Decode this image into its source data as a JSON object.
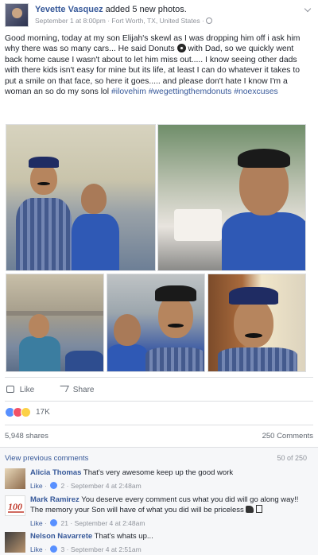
{
  "post": {
    "author": "Yevette Vasquez",
    "action": "added 5 new photos.",
    "date": "September 1 at 8:00pm",
    "location": "Fort Worth, TX, United States",
    "text_part1": "Good morning, today at my son Elijah's skewl as I was dropping him off i ask him why there was so many cars... He said Donuts",
    "text_part2": "with Dad, so we quickly went back home cause I wasn't about to let him miss out..... I know seeing other dads with there kids isn't easy for mine but its life, at least I can do whatever it takes to put a smile on that face, so here it goes..... and please don't hate I know I'm a woman an so do my sons lol",
    "hashtags": "#ilovehim #wegettingthemdonuts #noexcuses"
  },
  "actions": {
    "like_label": "Like",
    "share_label": "Share"
  },
  "stats": {
    "reaction_count": "17K",
    "shares": "5,948 shares",
    "comments": "250 Comments"
  },
  "comments_section": {
    "view_previous": "View previous comments",
    "count": "50 of 250",
    "items": [
      {
        "name": "Alicia Thomas",
        "text": "That's very awesome keep up the good work",
        "like_label": "Like",
        "reactions": "2",
        "time": "September 4 at 2:48am"
      },
      {
        "name": "Mark Ramirez",
        "text": "You deserve every comment cus what you did will go along way!! The memory your Son will have of what you did will be priceless",
        "like_label": "Like",
        "reactions": "21",
        "time": "September 4 at 2:48am"
      },
      {
        "name": "Nelson Navarrete",
        "text": "That's whats up...",
        "like_label": "Like",
        "reactions": "3",
        "time": "September 4 at 2:51am"
      }
    ]
  },
  "colors": {
    "link": "#365899",
    "like_reaction": "#5890ff",
    "love_reaction": "#f25268",
    "haha_reaction": "#fcd146",
    "meta_gray": "#90949c"
  },
  "icons": {
    "privacy": "globe-icon",
    "donut_emoji": "donut-emoji",
    "comment_emoji": "pointing-hand-emoji"
  }
}
